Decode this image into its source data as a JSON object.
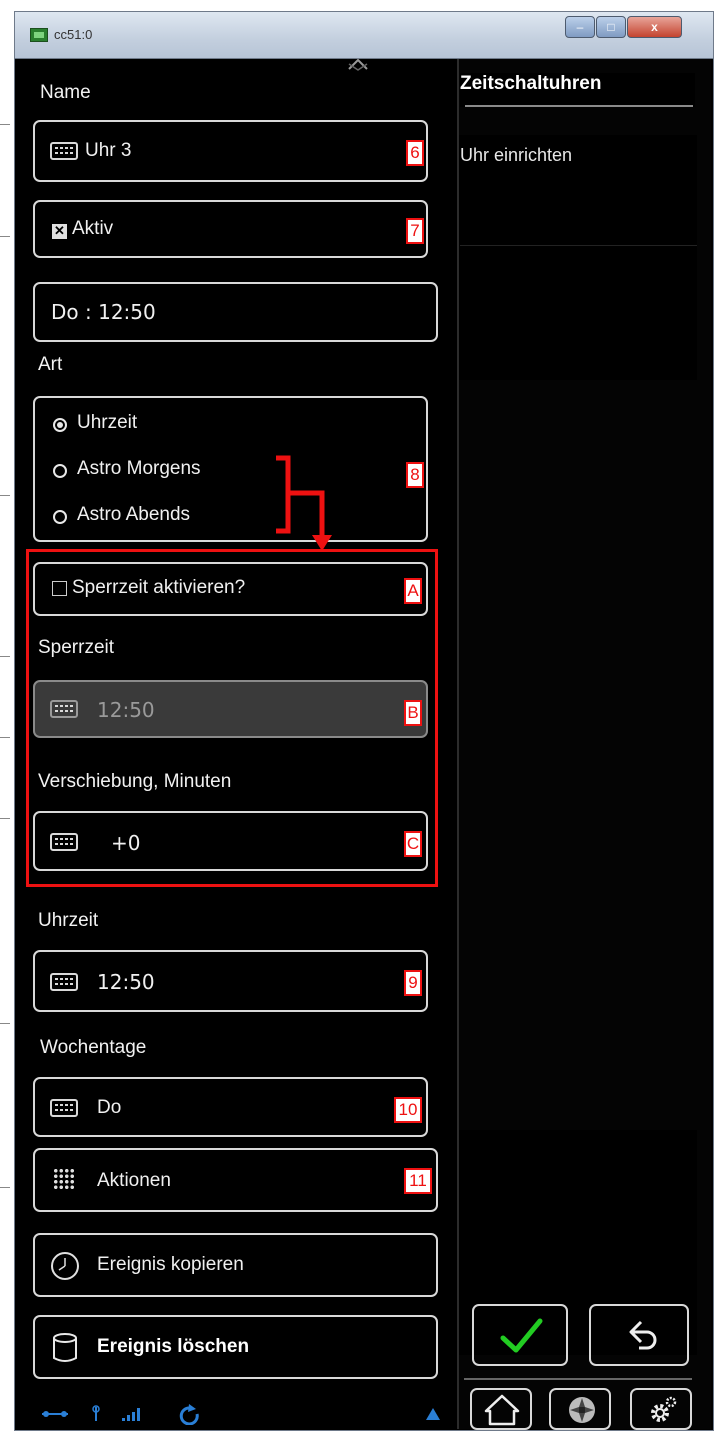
{
  "window": {
    "title": "cc51:0",
    "min": "–",
    "max": "□",
    "close": "x"
  },
  "form": {
    "name_label": "Name",
    "name_value": "Uhr 3",
    "tag_name": "6",
    "active_label": "Aktiv",
    "active_checked": true,
    "tag_active": "7",
    "summary": "Do : 12:50",
    "art_label": "Art",
    "art_options": [
      {
        "label": "Uhrzeit",
        "selected": true
      },
      {
        "label": "Astro Morgens",
        "selected": false
      },
      {
        "label": "Astro Abends",
        "selected": false
      }
    ],
    "tag_art": "8",
    "lock_label": "Sperrzeit aktivieren?",
    "lock_checked": false,
    "tag_lock": "A",
    "locktime_label": "Sperrzeit",
    "locktime_value": "12:50",
    "tag_locktime": "B",
    "shift_label": "Verschiebung, Minuten",
    "shift_value": "+0",
    "tag_shift": "C",
    "time_label": "Uhrzeit",
    "time_value": "12:50",
    "tag_time": "9",
    "weekdays_label": "Wochentage",
    "weekdays_value": "Do",
    "tag_weekdays": "10",
    "actions_label": "Aktionen",
    "tag_actions": "11",
    "copy_label": "Ereignis kopieren",
    "delete_label": "Ereignis löschen"
  },
  "sidebar": {
    "title": "Zeitschaltuhren",
    "item": "Uhr einrichten"
  },
  "colors": {
    "annotation": "#ee1111",
    "confirm": "#22cc22",
    "status": "#2a7fd6"
  },
  "icons": [
    "keyboard-icon",
    "checkbox-icon",
    "radio-icon",
    "grid-icon",
    "clock-icon",
    "trash-icon",
    "checkmark-icon",
    "undo-icon",
    "home-icon",
    "fan-icon",
    "gear-icon",
    "network-icon",
    "signal-icon",
    "refresh-icon",
    "collapse-icon"
  ]
}
